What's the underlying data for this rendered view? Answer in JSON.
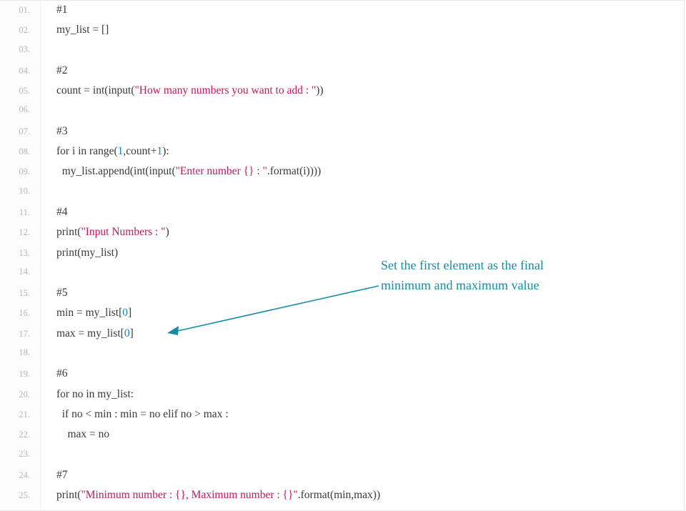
{
  "annotation": {
    "line1": "Set the first element as the final",
    "line2": "minimum and maximum value"
  },
  "colors": {
    "string": "#c2185b",
    "number": "#0288d1",
    "gutter_text": "#b8b8b8",
    "code_text": "#3a3a3a",
    "annotation": "#1a8ba6"
  },
  "code_lines": [
    {
      "n": "01.",
      "tokens": [
        {
          "t": "#1",
          "c": "plain"
        }
      ]
    },
    {
      "n": "02.",
      "tokens": [
        {
          "t": "my_list = []",
          "c": "plain"
        }
      ]
    },
    {
      "n": "03.",
      "tokens": []
    },
    {
      "n": "04.",
      "tokens": [
        {
          "t": "#2",
          "c": "plain"
        }
      ]
    },
    {
      "n": "05.",
      "tokens": [
        {
          "t": "count = int(input(",
          "c": "plain"
        },
        {
          "t": "\"How many numbers you want to add : \"",
          "c": "str"
        },
        {
          "t": "))",
          "c": "plain"
        }
      ]
    },
    {
      "n": "06.",
      "tokens": []
    },
    {
      "n": "07.",
      "tokens": [
        {
          "t": "#3",
          "c": "plain"
        }
      ]
    },
    {
      "n": "08.",
      "tokens": [
        {
          "t": "for i in range(",
          "c": "plain"
        },
        {
          "t": "1",
          "c": "num"
        },
        {
          "t": ",count+",
          "c": "plain"
        },
        {
          "t": "1",
          "c": "num"
        },
        {
          "t": "):",
          "c": "plain"
        }
      ]
    },
    {
      "n": "09.",
      "tokens": [
        {
          "t": "  my_list.append(int(input(",
          "c": "plain"
        },
        {
          "t": "\"Enter number {} : \"",
          "c": "str"
        },
        {
          "t": ".format(i))))",
          "c": "plain"
        }
      ]
    },
    {
      "n": "10.",
      "tokens": []
    },
    {
      "n": "11.",
      "tokens": [
        {
          "t": "#4",
          "c": "plain"
        }
      ]
    },
    {
      "n": "12.",
      "tokens": [
        {
          "t": "print(",
          "c": "plain"
        },
        {
          "t": "\"Input Numbers : \"",
          "c": "str"
        },
        {
          "t": ")",
          "c": "plain"
        }
      ]
    },
    {
      "n": "13.",
      "tokens": [
        {
          "t": "print(my_list)",
          "c": "plain"
        }
      ]
    },
    {
      "n": "14.",
      "tokens": []
    },
    {
      "n": "15.",
      "tokens": [
        {
          "t": "#5",
          "c": "plain"
        }
      ]
    },
    {
      "n": "16.",
      "tokens": [
        {
          "t": "min = my_list[",
          "c": "plain"
        },
        {
          "t": "0",
          "c": "num"
        },
        {
          "t": "]",
          "c": "plain"
        }
      ]
    },
    {
      "n": "17.",
      "tokens": [
        {
          "t": "max = my_list[",
          "c": "plain"
        },
        {
          "t": "0",
          "c": "num"
        },
        {
          "t": "]",
          "c": "plain"
        }
      ]
    },
    {
      "n": "18.",
      "tokens": []
    },
    {
      "n": "19.",
      "tokens": [
        {
          "t": "#6",
          "c": "plain"
        }
      ]
    },
    {
      "n": "20.",
      "tokens": [
        {
          "t": "for no in my_list:",
          "c": "plain"
        }
      ]
    },
    {
      "n": "21.",
      "tokens": [
        {
          "t": "  if no < min : min = no elif no > max :",
          "c": "plain"
        }
      ]
    },
    {
      "n": "22.",
      "tokens": [
        {
          "t": "    max = no",
          "c": "plain"
        }
      ]
    },
    {
      "n": "23.",
      "tokens": []
    },
    {
      "n": "24.",
      "tokens": [
        {
          "t": "#7",
          "c": "plain"
        }
      ]
    },
    {
      "n": "25.",
      "tokens": [
        {
          "t": "print(",
          "c": "plain"
        },
        {
          "t": "\"Minimum number : {}, Maximum number : {}\"",
          "c": "str"
        },
        {
          "t": ".format(min,max))",
          "c": "plain"
        }
      ]
    }
  ]
}
